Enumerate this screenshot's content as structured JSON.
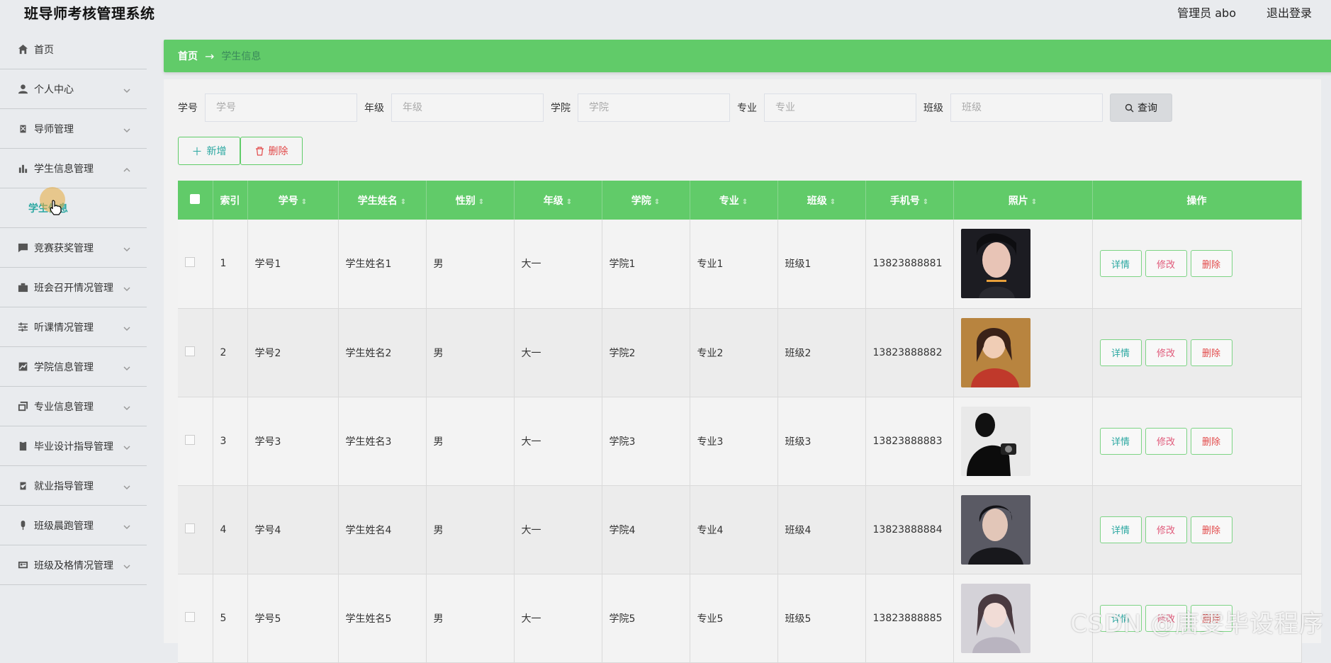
{
  "app": {
    "title": "班导师考核管理系统",
    "user": "管理员 abo",
    "logout": "退出登录"
  },
  "sidebar": {
    "items": [
      {
        "label": "首页",
        "icon": "home-icon"
      },
      {
        "label": "个人中心",
        "icon": "user-icon"
      },
      {
        "label": "导师管理",
        "icon": "clipboard-x-icon"
      },
      {
        "label": "学生信息管理",
        "icon": "bar-chart-icon",
        "expanded": true
      },
      {
        "label": "竞赛获奖管理",
        "icon": "chat-icon"
      },
      {
        "label": "班会召开情况管理",
        "icon": "briefcase-icon"
      },
      {
        "label": "听课情况管理",
        "icon": "sliders-icon"
      },
      {
        "label": "学院信息管理",
        "icon": "trend-chart-icon"
      },
      {
        "label": "专业信息管理",
        "icon": "copy-icon"
      },
      {
        "label": "毕业设计指导管理",
        "icon": "clipboard-icon"
      },
      {
        "label": "就业指导管理",
        "icon": "clipboard-check-icon"
      },
      {
        "label": "班级晨跑管理",
        "icon": "microphone-icon"
      },
      {
        "label": "班级及格情况管理",
        "icon": "id-card-icon"
      }
    ],
    "sub_item": "学生信息"
  },
  "breadcrumb": {
    "home": "首页",
    "arrow": "→",
    "current": "学生信息"
  },
  "search": {
    "fields": [
      {
        "label": "学号",
        "placeholder": "学号"
      },
      {
        "label": "年级",
        "placeholder": "年级"
      },
      {
        "label": "学院",
        "placeholder": "学院"
      },
      {
        "label": "专业",
        "placeholder": "专业"
      },
      {
        "label": "班级",
        "placeholder": "班级"
      }
    ],
    "query_label": "查询"
  },
  "actions": {
    "add_label": "新增",
    "delete_label": "删除"
  },
  "table": {
    "headers": [
      "索引",
      "学号",
      "学生姓名",
      "性别",
      "年级",
      "学院",
      "专业",
      "班级",
      "手机号",
      "照片",
      "操作"
    ],
    "rows": [
      {
        "index": "1",
        "id": "学号1",
        "name": "学生姓名1",
        "gender": "男",
        "grade": "大一",
        "college": "学院1",
        "major": "专业1",
        "class": "班级1",
        "phone": "13823888881"
      },
      {
        "index": "2",
        "id": "学号2",
        "name": "学生姓名2",
        "gender": "男",
        "grade": "大一",
        "college": "学院2",
        "major": "专业2",
        "class": "班级2",
        "phone": "13823888882"
      },
      {
        "index": "3",
        "id": "学号3",
        "name": "学生姓名3",
        "gender": "男",
        "grade": "大一",
        "college": "学院3",
        "major": "专业3",
        "class": "班级3",
        "phone": "13823888883"
      },
      {
        "index": "4",
        "id": "学号4",
        "name": "学生姓名4",
        "gender": "男",
        "grade": "大一",
        "college": "学院4",
        "major": "专业4",
        "class": "班级4",
        "phone": "13823888884"
      },
      {
        "index": "5",
        "id": "学号5",
        "name": "学生姓名5",
        "gender": "男",
        "grade": "大一",
        "college": "学院5",
        "major": "专业5",
        "class": "班级5",
        "phone": "13823888885"
      }
    ],
    "row_actions": {
      "detail": "详情",
      "edit": "修改",
      "delete": "删除"
    }
  },
  "watermark": "CSDN @唐雯毕设程序",
  "colors": {
    "accent": "#61cb69",
    "teal": "#2aa7a1",
    "danger": "#e24a4a"
  }
}
